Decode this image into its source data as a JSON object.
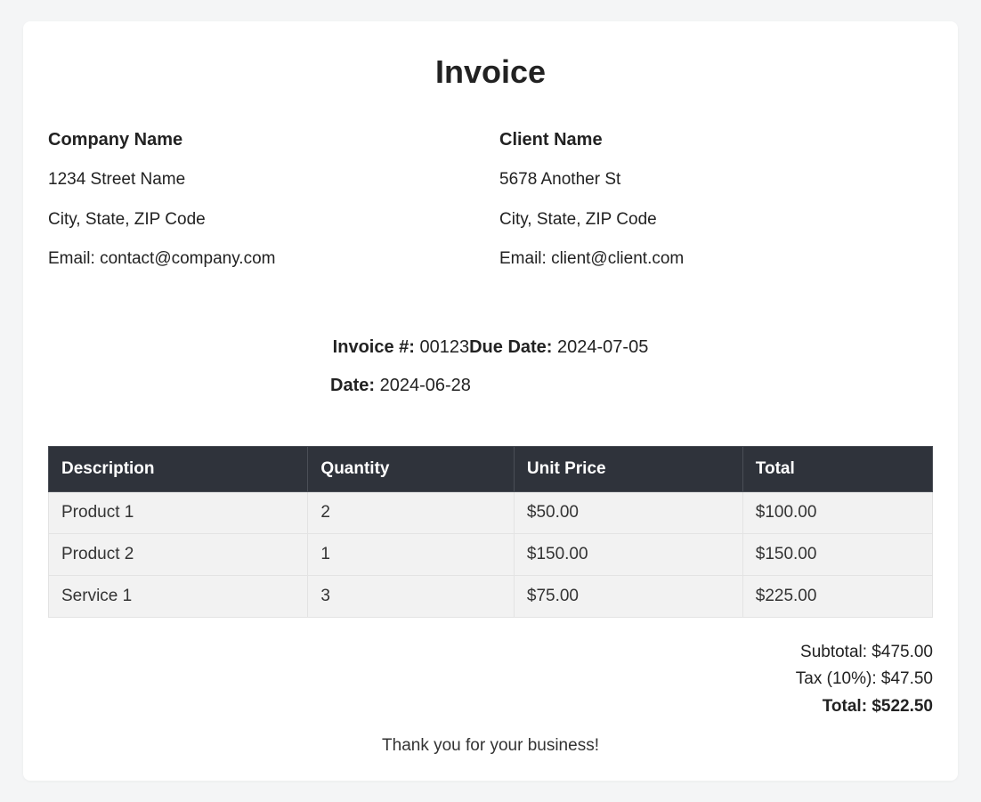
{
  "title": "Invoice",
  "company": {
    "name": "Company Name",
    "street": "1234 Street Name",
    "city_state_zip": "City, State, ZIP Code",
    "email_line": "Email: contact@company.com"
  },
  "client": {
    "name": "Client Name",
    "street": "5678 Another St",
    "city_state_zip": "City, State, ZIP Code",
    "email_line": "Email: client@client.com"
  },
  "meta": {
    "invoice_label": "Invoice #: ",
    "invoice_number": "00123",
    "due_label": "Due Date: ",
    "due_date": "2024-07-05",
    "date_label": "Date: ",
    "date": "2024-06-28"
  },
  "table": {
    "headers": {
      "description": "Description",
      "quantity": "Quantity",
      "unit_price": "Unit Price",
      "total": "Total"
    },
    "rows": [
      {
        "description": "Product 1",
        "quantity": "2",
        "unit_price": "$50.00",
        "total": "$100.00"
      },
      {
        "description": "Product 2",
        "quantity": "1",
        "unit_price": "$150.00",
        "total": "$150.00"
      },
      {
        "description": "Service 1",
        "quantity": "3",
        "unit_price": "$75.00",
        "total": "$225.00"
      }
    ]
  },
  "totals": {
    "subtotal": "Subtotal: $475.00",
    "tax": "Tax (10%): $47.50",
    "grand": "Total: $522.50"
  },
  "footer": {
    "thanks": "Thank you for your business!"
  }
}
